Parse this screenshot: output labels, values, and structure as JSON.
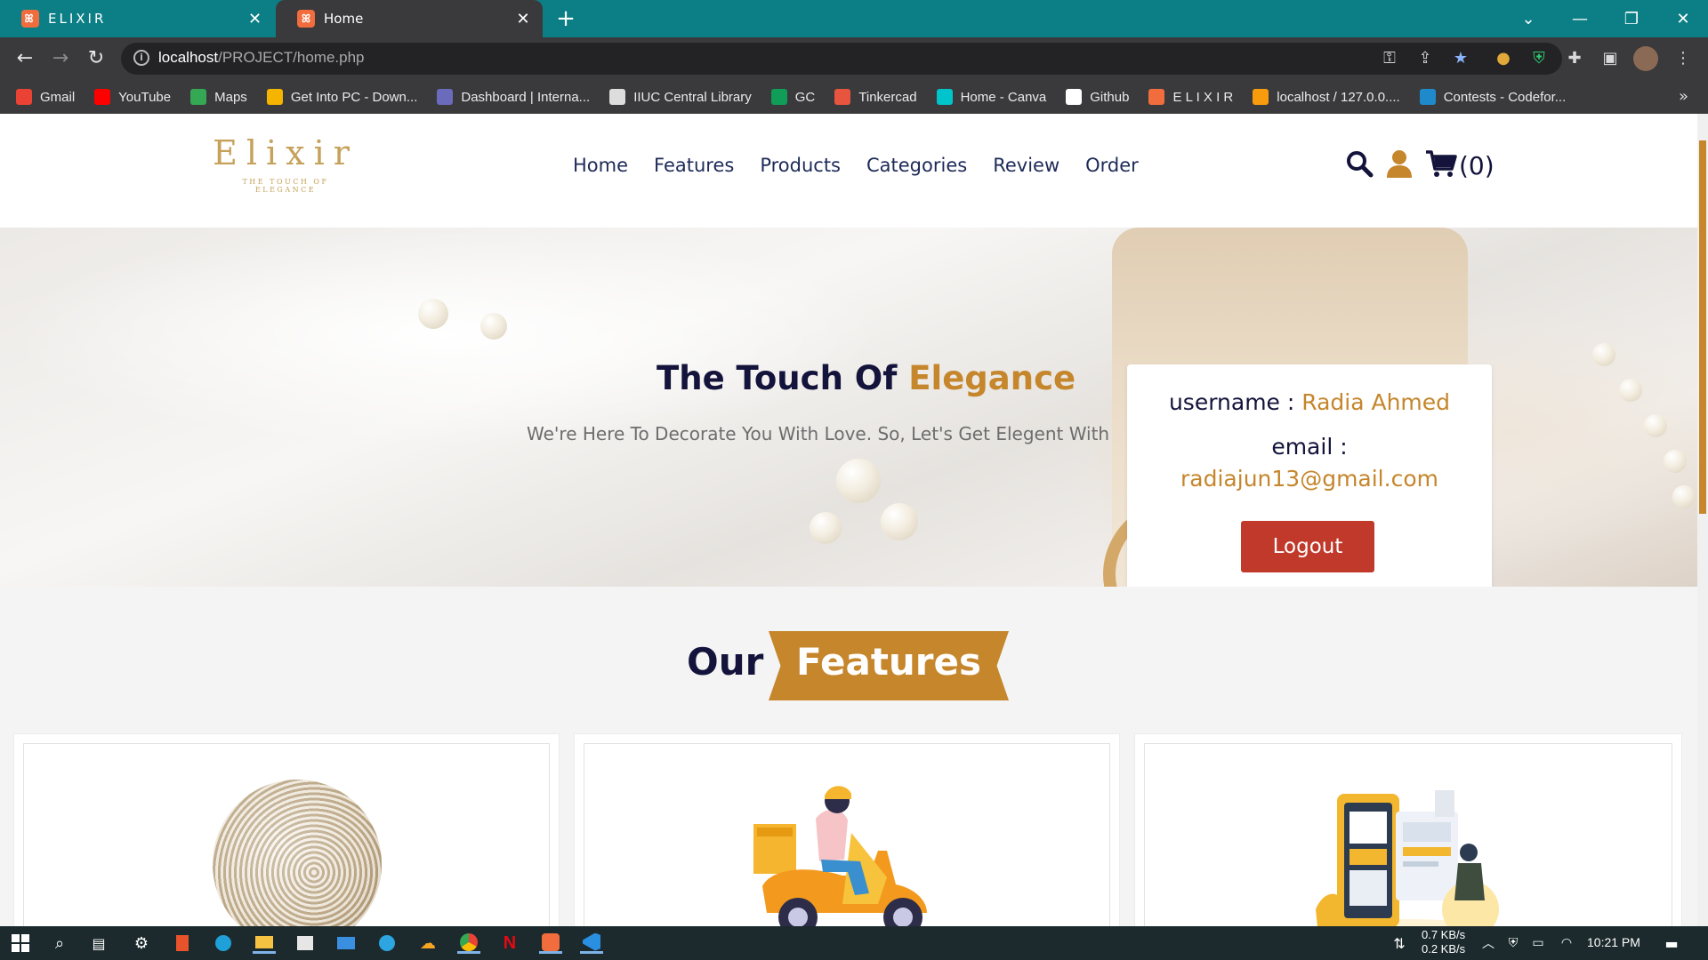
{
  "browser": {
    "tabs": [
      {
        "title": "ELIXIR",
        "active": false
      },
      {
        "title": "Home",
        "active": true
      }
    ],
    "url_host": "localhost",
    "url_path": "/PROJECT/home.php",
    "bookmarks": [
      {
        "label": "Gmail",
        "icon": "gmail-icon",
        "color": "#ea4335"
      },
      {
        "label": "YouTube",
        "icon": "youtube-icon",
        "color": "#ff0000"
      },
      {
        "label": "Maps",
        "icon": "maps-icon",
        "color": "#34a853"
      },
      {
        "label": "Get Into PC - Down...",
        "icon": "getintopc-icon",
        "color": "#f4b400"
      },
      {
        "label": "Dashboard | Interna...",
        "icon": "dashboard-icon",
        "color": "#6b6bbd"
      },
      {
        "label": "IIUC Central Library",
        "icon": "library-icon",
        "color": "#dddddd"
      },
      {
        "label": "GC",
        "icon": "classroom-icon",
        "color": "#0f9d58"
      },
      {
        "label": "Tinkercad",
        "icon": "tinkercad-icon",
        "color": "#e8553e"
      },
      {
        "label": "Home - Canva",
        "icon": "canva-icon",
        "color": "#00c4cc"
      },
      {
        "label": "Github",
        "icon": "github-icon",
        "color": "#ffffff"
      },
      {
        "label": "E L I X I R",
        "icon": "elixir-icon",
        "color": "#f26d3d"
      },
      {
        "label": "localhost / 127.0.0....",
        "icon": "phpmyadmin-icon",
        "color": "#f89c0e"
      },
      {
        "label": "Contests - Codefor...",
        "icon": "codeforces-icon",
        "color": "#1f8acb"
      }
    ]
  },
  "site": {
    "logo_word": "Elixir",
    "logo_tagline": "THE TOUCH OF ELEGANCE",
    "nav": [
      "Home",
      "Features",
      "Products",
      "Categories",
      "Review",
      "Order"
    ],
    "cart_count": "(0)",
    "hero": {
      "title_plain": "The Touch Of ",
      "title_accent": "Elegance",
      "subtitle": "We're Here To Decorate You With Love. So, Let's Get Elegent With"
    },
    "profile": {
      "username_label": "username : ",
      "username_value": "Radia Ahmed",
      "email_label": "email :",
      "email_value": "radiajun13@gmail.com",
      "logout_label": "Logout"
    },
    "features": {
      "heading_plain": "Our",
      "heading_badge": "Features"
    },
    "colors": {
      "accent": "#c5862c",
      "navy": "#13133b",
      "logout": "#c0392b"
    }
  },
  "taskbar": {
    "net_down": "0.7 KB/s",
    "net_up": "0.2 KB/s",
    "time": "10:21 PM"
  }
}
